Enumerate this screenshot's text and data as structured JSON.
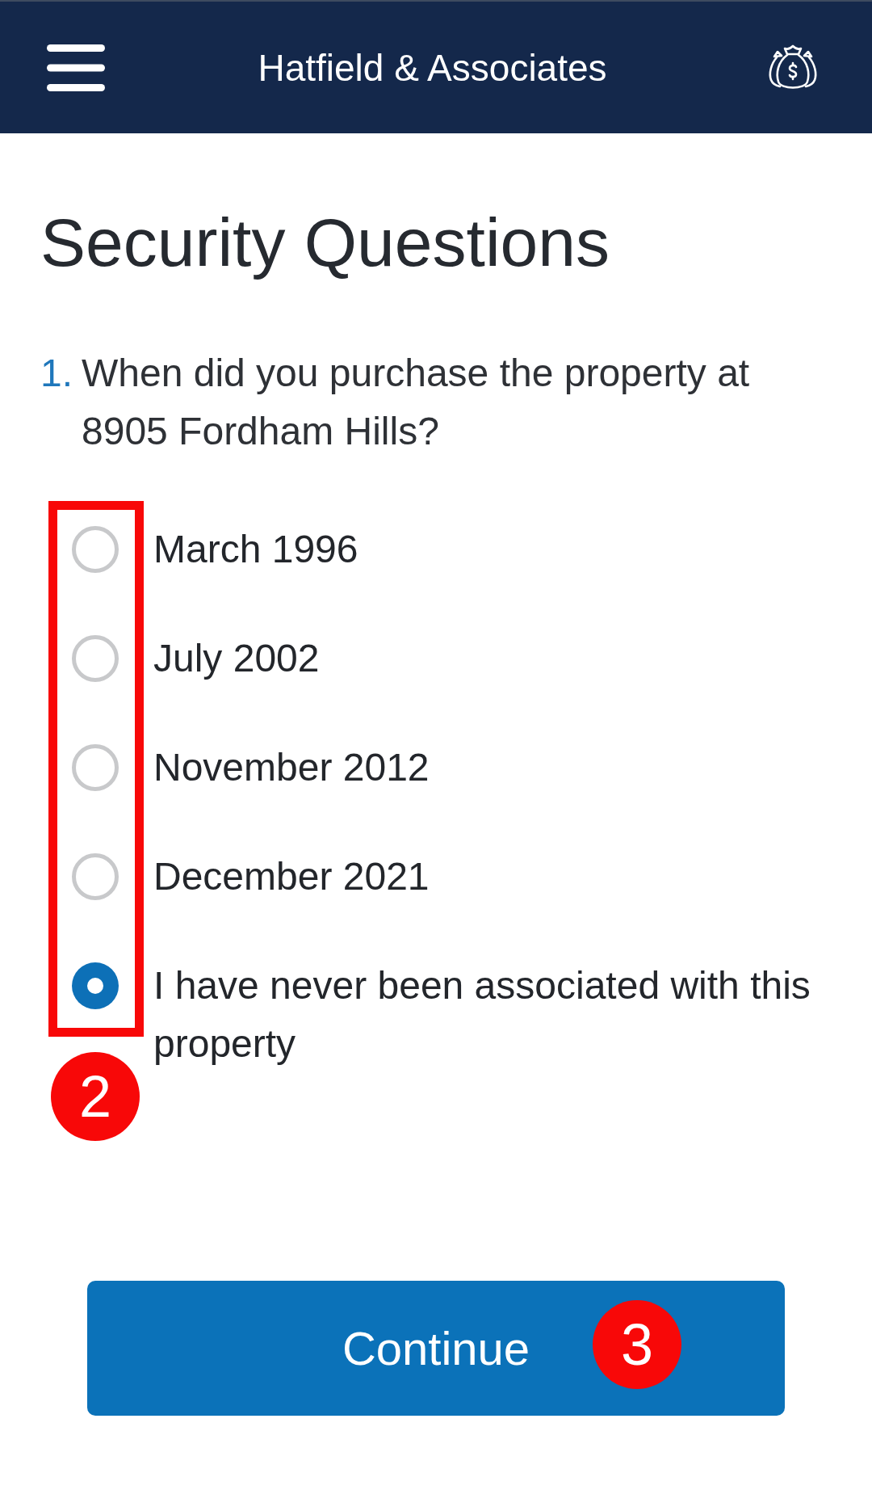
{
  "header": {
    "title": "Hatfield & Associates"
  },
  "heading": "Security Questions",
  "question": {
    "number": "1.",
    "text": "When did you purchase the property at 8905 Fordham Hills?",
    "options": [
      {
        "label": "March 1996",
        "selected": false
      },
      {
        "label": "July 2002",
        "selected": false
      },
      {
        "label": "November 2012",
        "selected": false
      },
      {
        "label": "December 2021",
        "selected": false
      },
      {
        "label": "I have never been associated with this property",
        "selected": true
      }
    ]
  },
  "continue_button": {
    "label": "Continue"
  },
  "annotations": [
    {
      "kind": "options_frame",
      "label": "2"
    },
    {
      "kind": "button_badge",
      "label": "3"
    }
  ]
}
